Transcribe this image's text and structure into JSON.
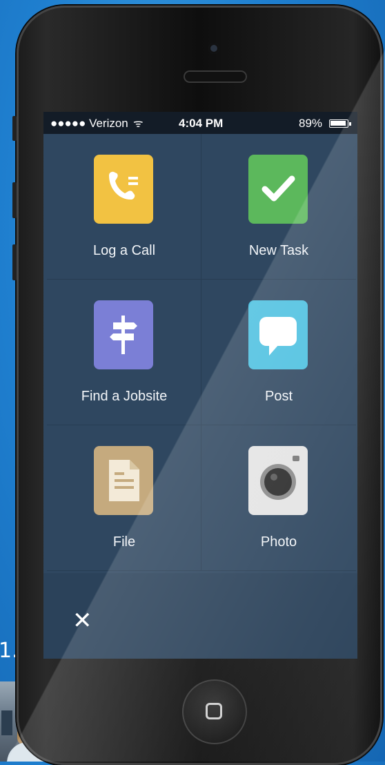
{
  "slide": {
    "number": "1."
  },
  "status_bar": {
    "carrier": "●●●●● Verizon",
    "wifi_glyph": "ᯤ",
    "time": "4:04 PM",
    "battery": "89%"
  },
  "menu": {
    "items": [
      {
        "label": "Log a Call",
        "icon": "phone-icon",
        "color": "#f2c242"
      },
      {
        "label": "New Task",
        "icon": "checkmark-icon",
        "color": "#5cb85c"
      },
      {
        "label": "Find a Jobsite",
        "icon": "signpost-icon",
        "color": "#7b7fd6"
      },
      {
        "label": "Post",
        "icon": "chat-bubble-icon",
        "color": "#4cc0e0"
      },
      {
        "label": "File",
        "icon": "document-icon",
        "color": "#c5aa7e"
      },
      {
        "label": "Photo",
        "icon": "camera-icon",
        "color": "#e4e4e4"
      }
    ]
  },
  "close": {
    "glyph": "✕"
  }
}
